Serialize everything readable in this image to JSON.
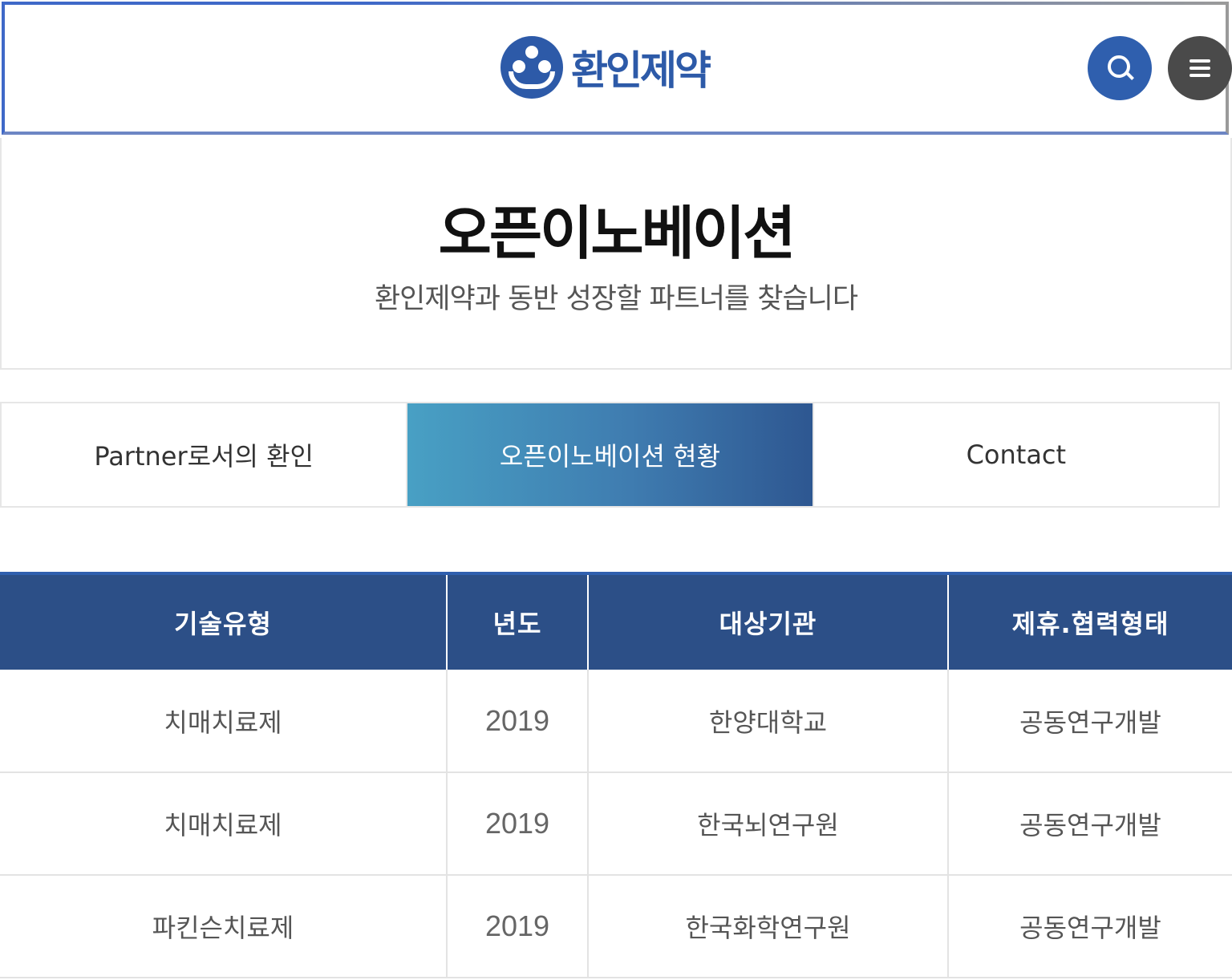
{
  "header": {
    "logo_text": "환인제약",
    "search_icon": "search-icon",
    "menu_icon": "hamburger-menu-icon",
    "brand_color": "#2d5aa8"
  },
  "hero": {
    "title": "오픈이노베이션",
    "subtitle": "환인제약과 동반 성장할 파트너를 찾습니다"
  },
  "tabs": [
    {
      "label": "Partner로서의 환인",
      "active": false
    },
    {
      "label": "오픈이노베이션 현황",
      "active": true
    },
    {
      "label": "Contact",
      "active": false
    }
  ],
  "table": {
    "headers": [
      "기술유형",
      "년도",
      "대상기관",
      "제휴.협력형태"
    ],
    "rows": [
      [
        "치매치료제",
        "2019",
        "한양대학교",
        "공동연구개발"
      ],
      [
        "치매치료제",
        "2019",
        "한국뇌연구원",
        "공동연구개발"
      ],
      [
        "파킨슨치료제",
        "2019",
        "한국화학연구원",
        "공동연구개발"
      ]
    ]
  }
}
